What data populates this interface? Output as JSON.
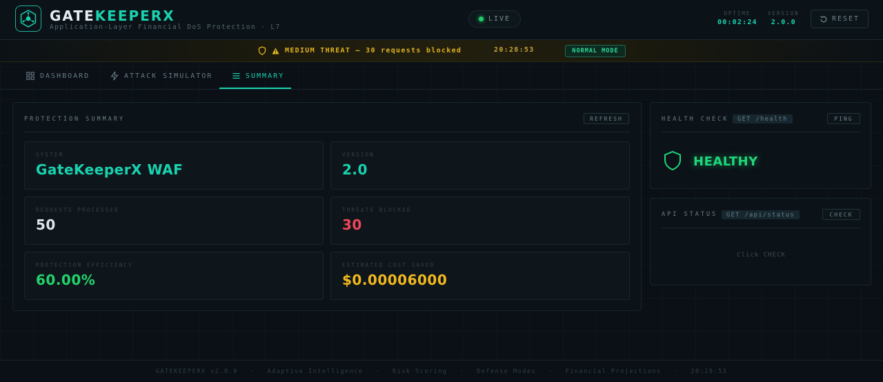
{
  "header": {
    "brand_prefix": "GATE",
    "brand_suffix": "KEEPERX",
    "tagline": "Application-Layer Financial DoS Protection · L7",
    "live_label": "LIVE",
    "uptime_label": "UPTIME",
    "uptime_value": "00:02:24",
    "version_label": "VERSION",
    "version_value": "2.0.0",
    "reset_label": "RESET"
  },
  "alert": {
    "text": "MEDIUM THREAT — 30 requests blocked",
    "time": "20:28:53",
    "mode": "NORMAL MODE"
  },
  "tabs": [
    {
      "label": "DASHBOARD",
      "icon": "grid-icon",
      "active": false
    },
    {
      "label": "ATTACK SIMULATOR",
      "icon": "bolt-icon",
      "active": false
    },
    {
      "label": "SUMMARY",
      "icon": "list-icon",
      "active": true
    }
  ],
  "summary": {
    "title": "PROTECTION SUMMARY",
    "refresh_label": "REFRESH",
    "cards": [
      {
        "label": "SYSTEM",
        "value": "GateKeeperX WAF",
        "color": "#19d3b0"
      },
      {
        "label": "VERSION",
        "value": "2.0",
        "color": "#19d3b0"
      },
      {
        "label": "REQUESTS PROCESSED",
        "value": "50",
        "color": "#dfe7ec"
      },
      {
        "label": "THREATS BLOCKED",
        "value": "30",
        "color": "#f0465a"
      },
      {
        "label": "PROTECTION EFFICIENCY",
        "value": "60.00%",
        "color": "#22d36c"
      },
      {
        "label": "ESTIMATED COST SAVED",
        "value": "$0.00006000",
        "color": "#f2b81c"
      }
    ]
  },
  "health": {
    "title": "HEALTH CHECK",
    "endpoint": "GET /health",
    "ping_label": "PING",
    "status": "HEALTHY"
  },
  "api_status": {
    "title": "API STATUS",
    "endpoint": "GET /api/status",
    "check_label": "CHECK",
    "placeholder": "Click CHECK"
  },
  "footer": {
    "items": [
      "GATEKEEPERX v2.0.0",
      "·",
      "Adaptive Intelligence",
      "·",
      "Risk Scoring",
      "·",
      "Defense Modes",
      "·",
      "Financial Projections",
      "·",
      "20:28:53"
    ]
  },
  "colors": {
    "accent": "#19d3b0",
    "warning": "#e1b321",
    "danger": "#f0465a",
    "success": "#22d36c"
  }
}
